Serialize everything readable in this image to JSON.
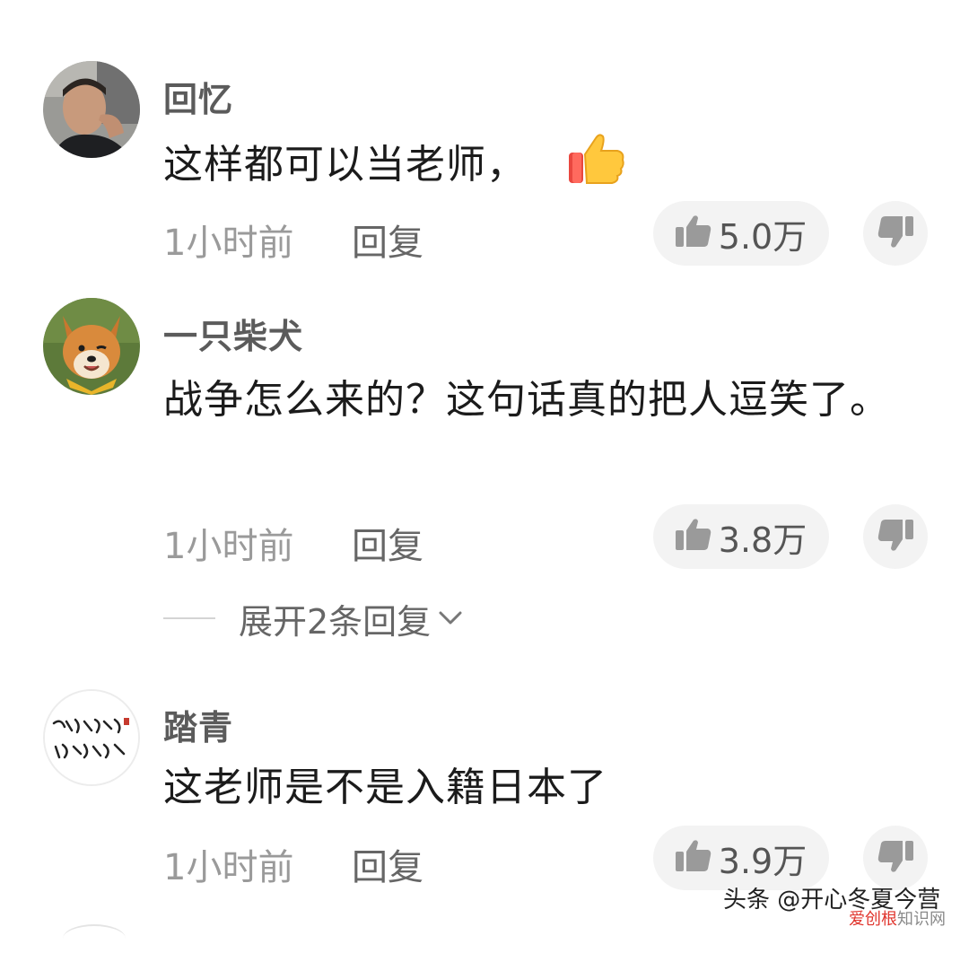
{
  "comments": [
    {
      "username": "回忆",
      "text": "这样都可以当老师，",
      "emoji": "thumbs-up-emoji",
      "time": "1小时前",
      "reply_label": "回复",
      "like_count": "5.0万"
    },
    {
      "username": "一只柴犬",
      "text": "战争怎么来的？这句话真的把人逗笑了。",
      "time": "1小时前",
      "reply_label": "回复",
      "like_count": "3.8万",
      "expand_label": "展开2条回复"
    },
    {
      "username": "踏青",
      "text": "这老师是不是入籍日本了",
      "time": "1小时前",
      "reply_label": "回复",
      "like_count": "3.9万"
    }
  ],
  "watermark": {
    "main": "头条 @开心冬夏今营",
    "sub_red": "爱创根",
    "sub_gray": "知识网"
  },
  "colors": {
    "username": "#5b5b5b",
    "text": "#1b1b1b",
    "meta": "#9a9a9a",
    "pill_bg": "#f3f3f3"
  }
}
